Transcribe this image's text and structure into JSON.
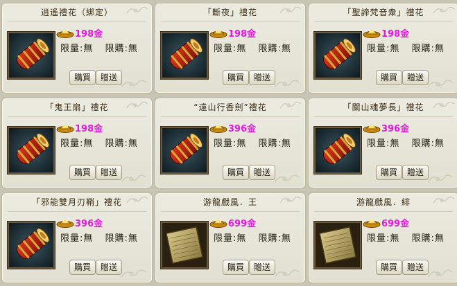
{
  "labels": {
    "limit_qty": "限量:無",
    "limit_buy": "限購:無",
    "buy": "購買",
    "gift": "贈送"
  },
  "colors": {
    "price": "#e21adf",
    "panel": "#e8e6da",
    "border": "#b9b49c"
  },
  "items": [
    {
      "title": "逍遙禮花（綁定）",
      "price": "198金",
      "image": "firecracker-icon"
    },
    {
      "title": "「斷夜」禮花",
      "price": "198金",
      "image": "firecracker-icon"
    },
    {
      "title": "「聖諦梵音衆」禮花",
      "price": "198金",
      "image": "firecracker-icon"
    },
    {
      "title": "「鬼王扇」禮花",
      "price": "198金",
      "image": "firecracker-icon"
    },
    {
      "title": "“遠山行香劍”禮花",
      "price": "396金",
      "image": "firecracker-icon"
    },
    {
      "title": "「關山魂夢長」禮花",
      "price": "396金",
      "image": "firecracker-icon"
    },
    {
      "title": "「邪能雙月刃鞘」禮花",
      "price": "396金",
      "image": "firecracker-icon"
    },
    {
      "title": "游龍戲風．王",
      "price": "699金",
      "image": "scroll-icon"
    },
    {
      "title": "游龍戲風．緋",
      "price": "699金",
      "image": "scroll-icon"
    }
  ]
}
